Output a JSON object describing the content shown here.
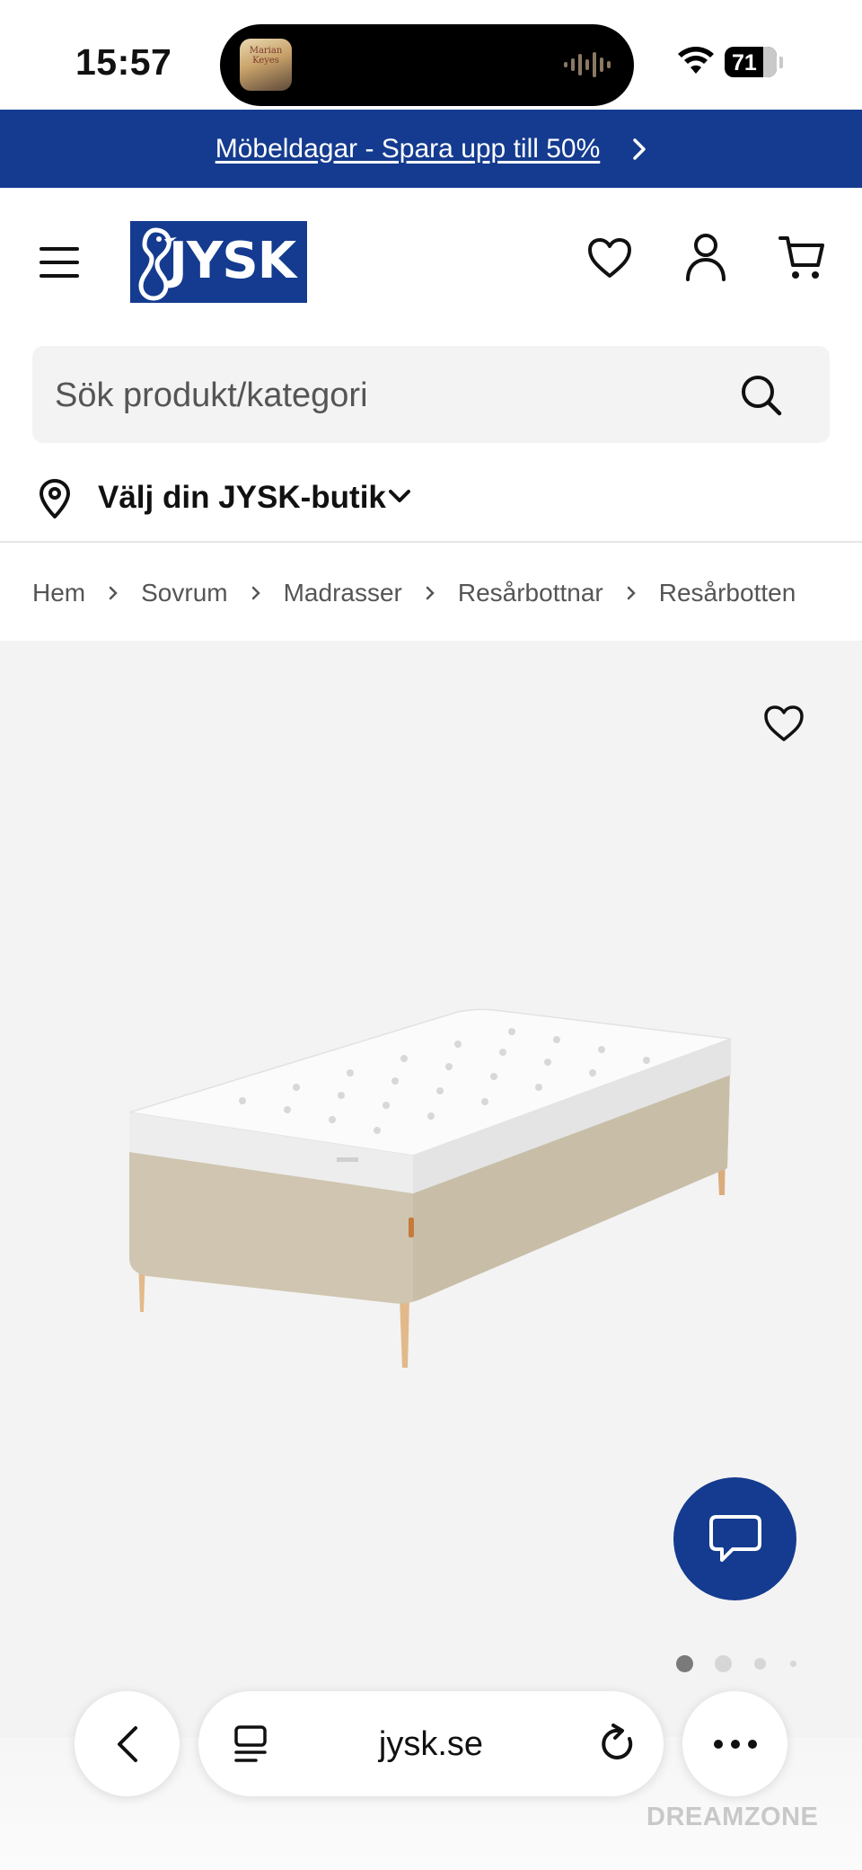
{
  "status_bar": {
    "time": "15:57",
    "battery": "71",
    "now_playing_art_text": "Marian Keyes"
  },
  "promo": {
    "text": "Möbeldagar - Spara upp till 50%"
  },
  "header": {
    "logo_text": "JYSK",
    "icons": [
      "menu-icon",
      "heart-icon",
      "account-icon",
      "cart-icon"
    ]
  },
  "search": {
    "placeholder": "Sök produkt/kategori"
  },
  "store": {
    "label": "Välj din JYSK-butik"
  },
  "breadcrumb": [
    "Hem",
    "Sovrum",
    "Madrasser",
    "Resårbottnar",
    "Resårbotten"
  ],
  "gallery": {
    "total_images": 4,
    "active_index": 0
  },
  "browser": {
    "url": "jysk.se"
  },
  "watermark": "DREAMZONE",
  "colors": {
    "brand_blue": "#143b8f",
    "page_bg": "#ffffff",
    "gallery_bg": "#f3f3f3"
  }
}
